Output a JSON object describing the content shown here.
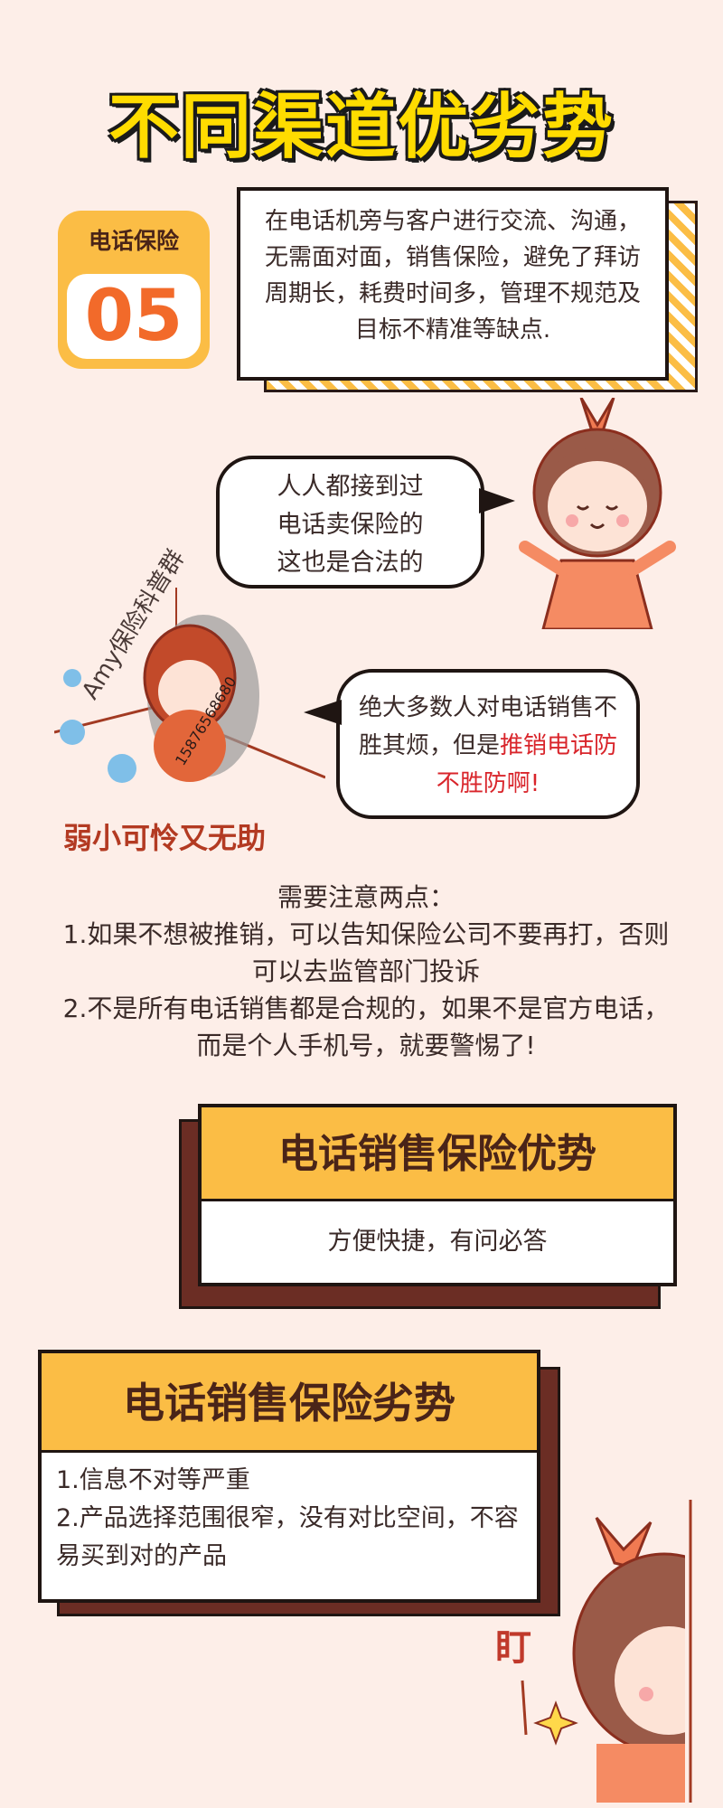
{
  "title": "不同渠道优劣势",
  "badge": {
    "label": "电话保险",
    "number": "05"
  },
  "intro": "在电话机旁与客户进行交流、沟通，无需面对面，销售保险，避免了拜访周期长，耗费时间多，管理不规范及目标不精准等缺点.",
  "bubble1": {
    "lines": [
      "人人都接到过",
      "电话卖保险的",
      "这也是合法的"
    ]
  },
  "bubble2": {
    "text": "绝大多数人对电话销售不胜其烦，但是",
    "highlight": "推销电话防不胜防啊!"
  },
  "sad_label": "弱小可怜又无助",
  "watermark": {
    "name": "Amy保险科普群",
    "phone": "15876568680"
  },
  "notes": {
    "heading": "需要注意两点：",
    "item1": "1.如果不想被推销，可以告知保险公司不要再打，否则可以去监管部门投诉",
    "item2": "2.不是所有电话销售都是合规的，如果不是官方电话，而是个人手机号，就要警惕了!"
  },
  "advantages": {
    "title": "电话销售保险优势",
    "body": "方便快捷，有问必答"
  },
  "disadvantages": {
    "title": "电话销售保险劣势",
    "items": [
      "1.信息不对等严重",
      "2.产品选择范围很窄，没有对比空间，不容易买到对的产品"
    ]
  },
  "peek_text": "盯",
  "colors": {
    "background": "#fdeee8",
    "yellow": "#fbbd45",
    "brown": "#6b2d24",
    "orange": "#f26a2a",
    "highlight_red": "#d9252b"
  }
}
